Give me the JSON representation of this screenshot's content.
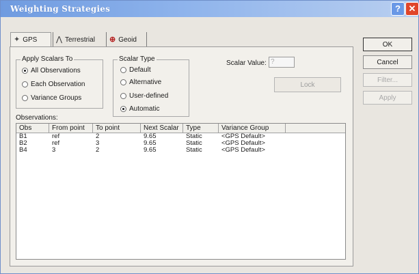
{
  "window": {
    "title": "Weighting Strategies",
    "help_label": "?",
    "close_label": "✕"
  },
  "tabs": [
    {
      "label": "GPS",
      "icon": "satellite-icon"
    },
    {
      "label": "Terrestrial",
      "icon": "tripod-icon"
    },
    {
      "label": "Geoid",
      "icon": "globe-icon"
    }
  ],
  "apply_scalars": {
    "title": "Apply Scalars To",
    "options": [
      "All Observations",
      "Each Observation",
      "Variance Groups"
    ],
    "selected": "All Observations"
  },
  "scalar_type": {
    "title": "Scalar Type",
    "options": [
      "Default",
      "Alternative",
      "User-defined",
      "Automatic"
    ],
    "selected": "Automatic"
  },
  "scalar_value": {
    "label": "Scalar Value:",
    "value": "?"
  },
  "lock_label": "Lock",
  "observations": {
    "label": "Observations:",
    "columns": [
      "Obs",
      "From point",
      "To point",
      "Next Scalar",
      "Type",
      "Variance Group"
    ],
    "rows": [
      [
        "B1",
        "ref",
        "2",
        "9.65",
        "Static",
        "<GPS Default>"
      ],
      [
        "B2",
        "ref",
        "3",
        "9.65",
        "Static",
        "<GPS Default>"
      ],
      [
        "B4",
        "3",
        "2",
        "9.65",
        "Static",
        "<GPS Default>"
      ]
    ]
  },
  "buttons": {
    "ok": "OK",
    "cancel": "Cancel",
    "filter": "Filter...",
    "apply": "Apply"
  },
  "colors": {
    "title_bar": "#6f9be0",
    "close_button": "#e0452a",
    "dialog_bg": "#e9e6e0"
  }
}
